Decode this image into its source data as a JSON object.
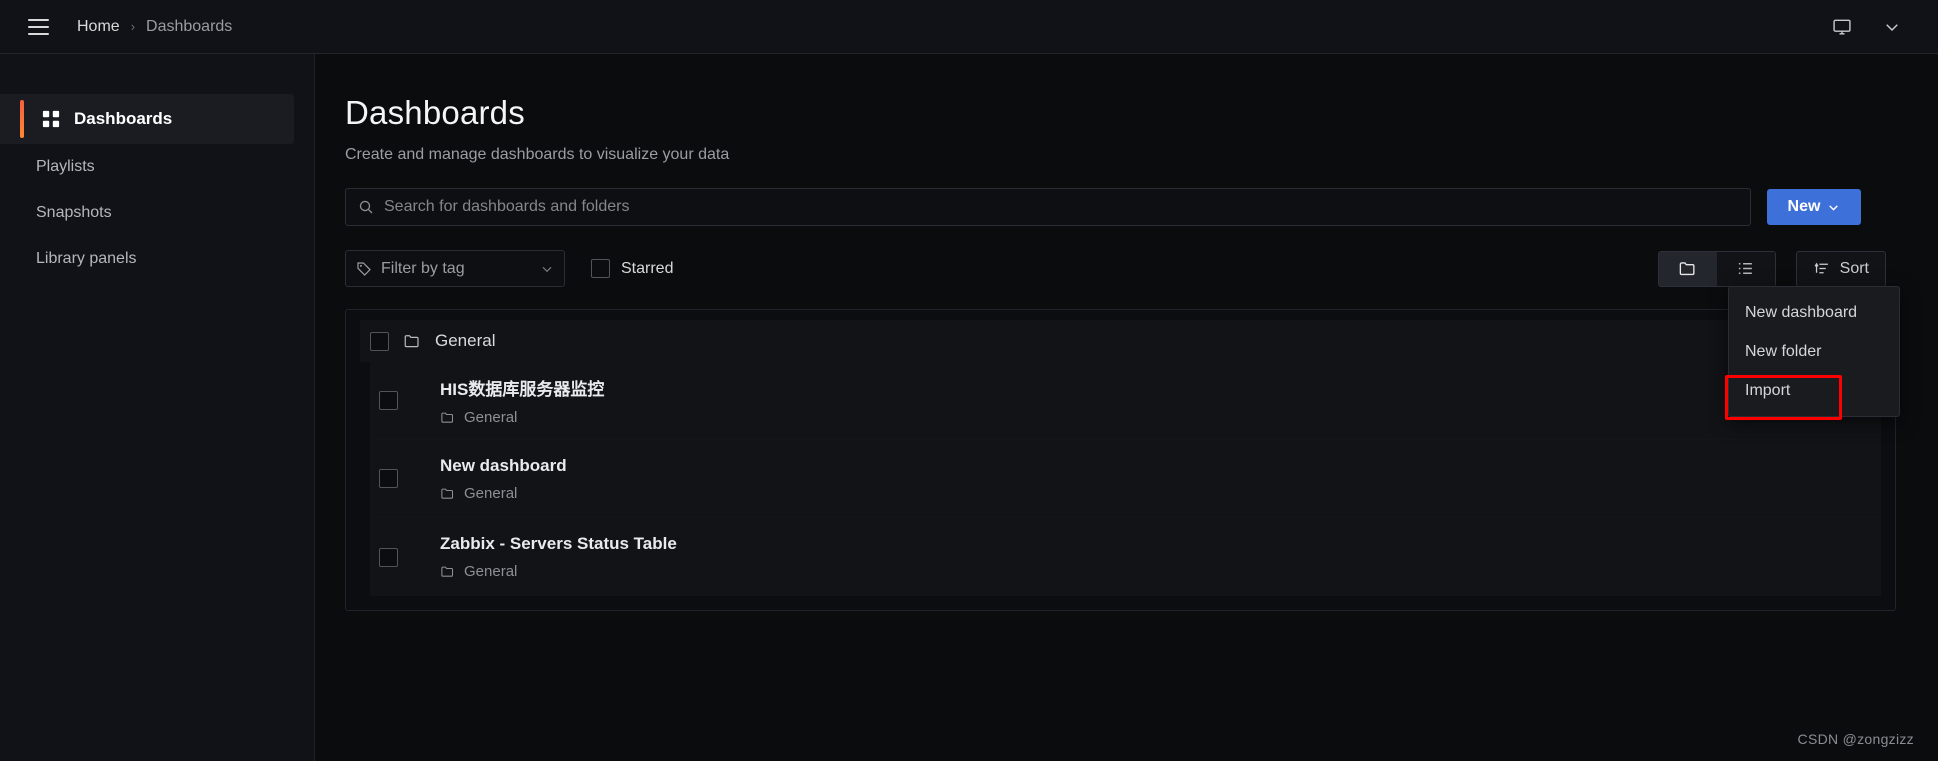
{
  "topbar": {
    "menu_icon": "hamburger-icon",
    "breadcrumb": {
      "home": "Home",
      "separator": "›",
      "current": "Dashboards"
    },
    "display_icon": "monitor-icon",
    "chevron_icon": "chevron-down-icon"
  },
  "sidebar": {
    "items": [
      {
        "label": "Dashboards",
        "icon": "apps-grid-icon",
        "active": true
      },
      {
        "label": "Playlists",
        "icon": "",
        "active": false
      },
      {
        "label": "Snapshots",
        "icon": "",
        "active": false
      },
      {
        "label": "Library panels",
        "icon": "",
        "active": false
      }
    ]
  },
  "page": {
    "title": "Dashboards",
    "subtitle": "Create and manage dashboards to visualize your data"
  },
  "search": {
    "placeholder": "Search for dashboards and folders",
    "value": "",
    "icon": "search-icon"
  },
  "new_button": {
    "label": "New",
    "icon": "chevron-down-icon",
    "color": "#3d71d9"
  },
  "new_menu": {
    "items": [
      {
        "label": "New dashboard"
      },
      {
        "label": "New folder"
      },
      {
        "label": "Import",
        "highlighted": true
      }
    ],
    "highlight_color": "#fe0000"
  },
  "filters": {
    "tag_filter": {
      "label": "Filter by tag",
      "icon": "tag-icon",
      "chevron": "chevron-down-icon"
    },
    "starred": {
      "label": "Starred",
      "checked": false
    },
    "view_toggle": {
      "options": [
        {
          "icon": "folder-view-icon",
          "selected": true
        },
        {
          "icon": "list-view-icon",
          "selected": false
        }
      ]
    },
    "sort": {
      "label": "Sort",
      "icon": "sort-amount-icon"
    }
  },
  "list": {
    "folder": {
      "label": "General",
      "icon": "folder-icon",
      "checked": false
    },
    "dashboards": [
      {
        "title": "HIS数据库服务器监控",
        "folder": "General",
        "icon": "folder-icon",
        "checked": false
      },
      {
        "title": "New dashboard",
        "folder": "General",
        "icon": "folder-icon",
        "checked": false
      },
      {
        "title": "Zabbix - Servers Status Table",
        "folder": "General",
        "icon": "folder-icon",
        "checked": false
      }
    ]
  },
  "watermark": {
    "text": "CSDN @zongzizz"
  }
}
